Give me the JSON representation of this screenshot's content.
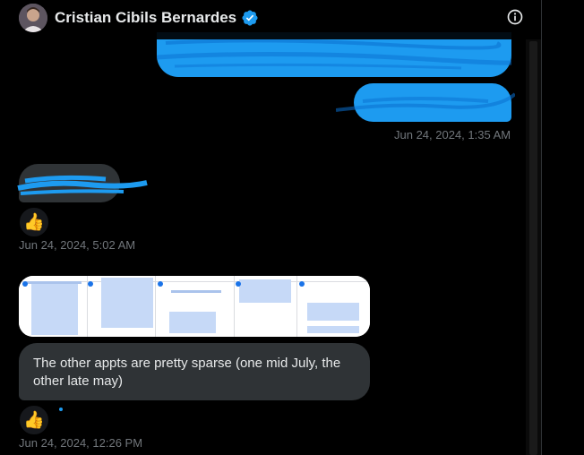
{
  "header": {
    "name": "Cristian Cibils Bernardes",
    "verified_icon": "verified-badge-icon",
    "info_icon": "info-icon",
    "avatar_icon": "avatar"
  },
  "messages": {
    "outgoing_1_timestamp": "Jun 24, 2024, 1:35 AM",
    "incoming_1_reaction": "👍",
    "incoming_1_timestamp": "Jun 24, 2024, 5:02 AM",
    "incoming_2_text": "The other appts are pretty sparse (one mid July, the other late may)",
    "incoming_2_reaction": "👍",
    "incoming_2_timestamp": "Jun 24, 2024, 12:26 PM"
  },
  "colors": {
    "accent": "#1d9bf0",
    "bubble_in": "#2f3336",
    "background": "#000000",
    "timestamp": "#71767b"
  }
}
